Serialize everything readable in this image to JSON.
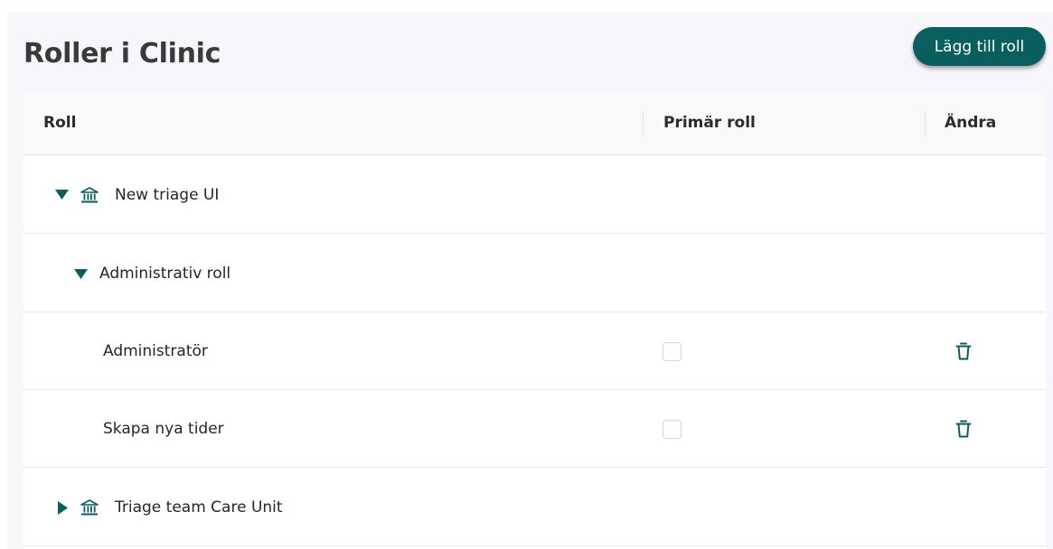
{
  "header": {
    "title": "Roller i Clinic",
    "add_button_label": "Lägg till roll"
  },
  "table": {
    "columns": [
      "Roll",
      "Primär roll",
      "Ändra"
    ],
    "rows": [
      {
        "type": "unit",
        "label": "New triage UI",
        "expanded": true,
        "icon": "bank-icon"
      },
      {
        "type": "group",
        "label": "Administrativ roll",
        "expanded": true
      },
      {
        "type": "role",
        "label": "Administratör",
        "primary": false,
        "action_icon": "trash-icon"
      },
      {
        "type": "role",
        "label": "Skapa nya tider",
        "primary": false,
        "action_icon": "trash-icon"
      },
      {
        "type": "unit",
        "label": "Triage team Care Unit",
        "expanded": false,
        "icon": "bank-icon"
      }
    ]
  },
  "colors": {
    "accent": "#0a5e5d",
    "background": "#f7f6fb"
  }
}
